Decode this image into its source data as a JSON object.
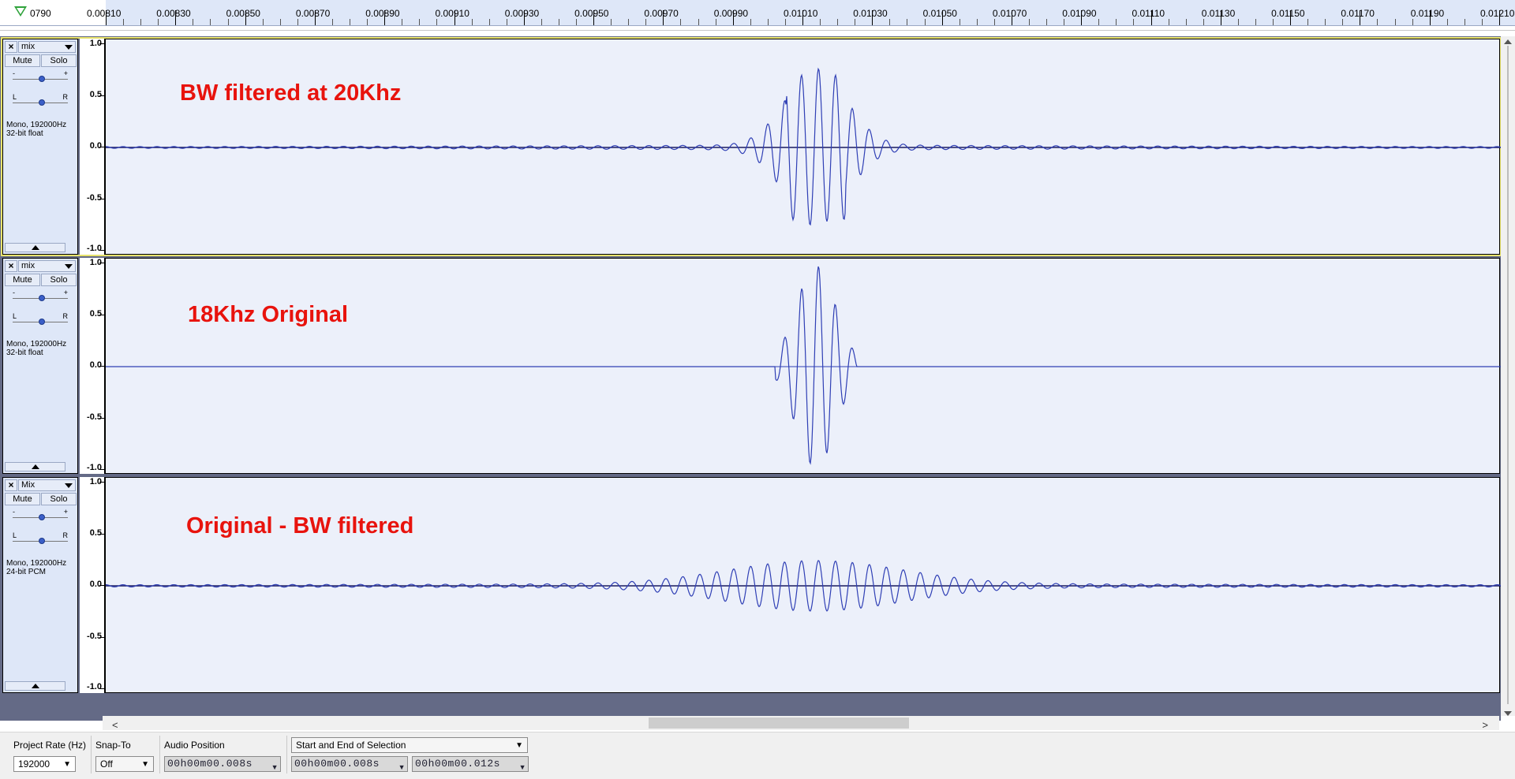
{
  "ruler": {
    "edge_label": "0790",
    "ticks": [
      "0.00810",
      "0.00830",
      "0.00850",
      "0.00870",
      "0.00890",
      "0.00910",
      "0.00930",
      "0.00950",
      "0.00970",
      "0.00990",
      "0.01010",
      "0.01030",
      "0.01050",
      "0.01070",
      "0.01090",
      "0.01110",
      "0.01130",
      "0.01150",
      "0.01170",
      "0.01190",
      "0.01210"
    ]
  },
  "tracks": [
    {
      "name": "mix",
      "mute_label": "Mute",
      "solo_label": "Solo",
      "gain_minus": "-",
      "gain_plus": "+",
      "pan_left": "L",
      "pan_right": "R",
      "info_line1": "Mono, 192000Hz",
      "info_line2": "32-bit float",
      "overlay_label": "BW filtered at 20Khz",
      "selected": true,
      "y_labels": [
        "1.0",
        "0.5",
        "0.0",
        "-0.5",
        "-1.0"
      ]
    },
    {
      "name": "mix",
      "mute_label": "Mute",
      "solo_label": "Solo",
      "gain_minus": "-",
      "gain_plus": "+",
      "pan_left": "L",
      "pan_right": "R",
      "info_line1": "Mono, 192000Hz",
      "info_line2": "32-bit float",
      "overlay_label": "18Khz Original",
      "selected": false,
      "y_labels": [
        "1.0",
        "0.5",
        "0.0",
        "-0.5",
        "-1.0"
      ]
    },
    {
      "name": "Mix",
      "mute_label": "Mute",
      "solo_label": "Solo",
      "gain_minus": "-",
      "gain_plus": "+",
      "pan_left": "L",
      "pan_right": "R",
      "info_line1": "Mono, 192000Hz",
      "info_line2": "24-bit PCM",
      "overlay_label": "Original - BW filtered",
      "selected": false,
      "y_labels": [
        "1.0",
        "0.5",
        "0.0",
        "-0.5",
        "-1.0"
      ]
    }
  ],
  "waveform_color": "#2f3fb5",
  "selection_toolbar": {
    "project_rate_label": "Project Rate (Hz)",
    "project_rate_value": "192000",
    "snap_to_label": "Snap-To",
    "snap_to_value": "Off",
    "audio_position_label": "Audio Position",
    "audio_position_value": "00h00m00.008s",
    "selection_mode": "Start and End of Selection",
    "selection_start": "00h00m00.008s",
    "selection_end": "00h00m00.012s"
  },
  "hscroll": {
    "left_arrow": "<",
    "right_arrow": ">"
  }
}
